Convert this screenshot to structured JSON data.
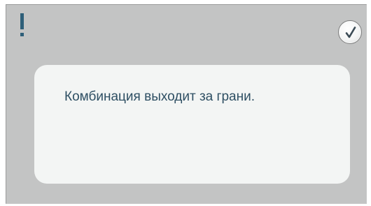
{
  "dialog": {
    "alert_symbol": "!",
    "alert_icon": "exclamation-icon",
    "confirm_icon": "checkmark-icon",
    "message": "Комбинация выходит за грани."
  },
  "colors": {
    "background": "#c3c4c4",
    "panel": "#f3f5f4",
    "accent": "#2e5f79",
    "text": "#2e4f63"
  }
}
